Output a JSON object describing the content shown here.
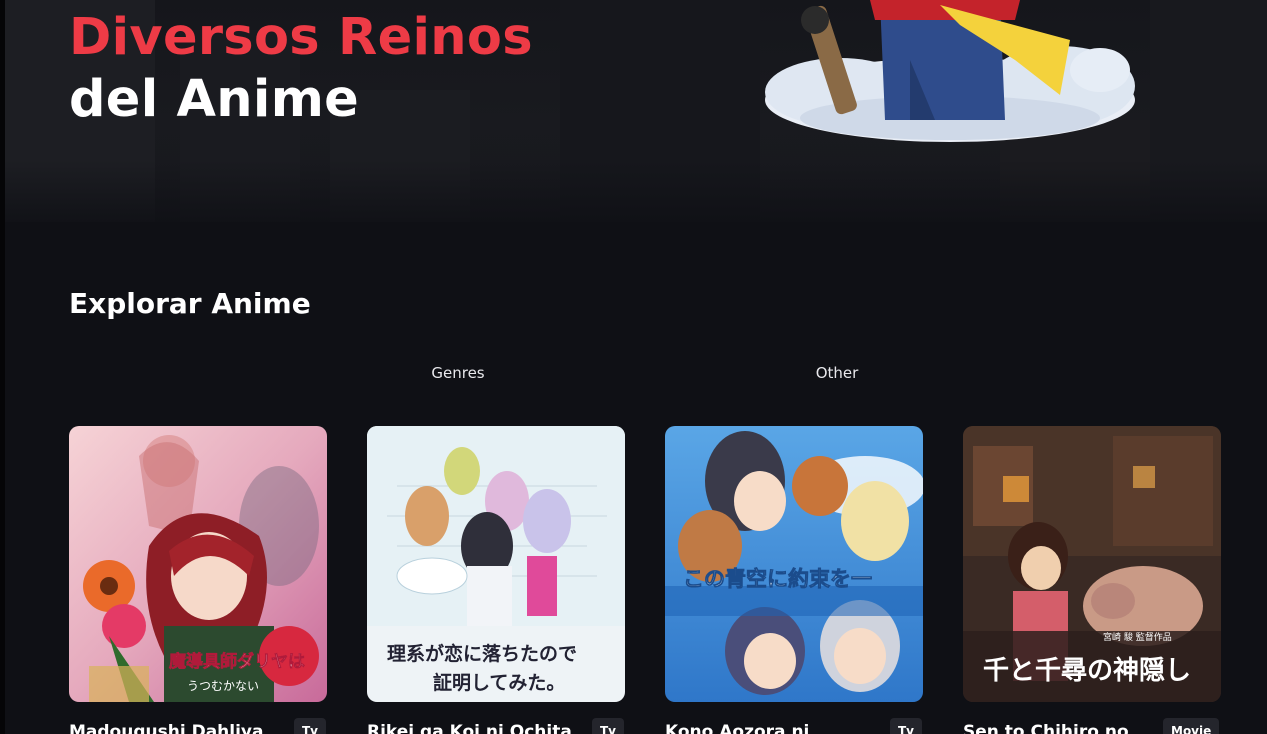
{
  "hero": {
    "title_accent": "Diversos Reinos",
    "title_main": "del Anime"
  },
  "explore": {
    "title": "Explorar Anime",
    "tabs": [
      {
        "label": "Genres"
      },
      {
        "label": "Other"
      }
    ]
  },
  "cards": [
    {
      "title": "Madougushi Dahliya",
      "type": "Tv",
      "poster_text": "魔導具師ダリヤは",
      "poster_subtext": "うつむかない"
    },
    {
      "title": "Rikei ga Koi ni Ochita",
      "type": "Tv",
      "poster_text": "理系が恋に落ちたので",
      "poster_subtext": "証明してみた。"
    },
    {
      "title": "Kono Aozora ni",
      "type": "Tv",
      "poster_text": "この青空に約束を一",
      "poster_subtext": ""
    },
    {
      "title": "Sen to Chihiro no",
      "type": "Movie",
      "poster_text": "千と千尋の神隠し",
      "poster_subtext": "宮崎 駿 監督作品"
    }
  ],
  "colors": {
    "background": "#0f1015",
    "accent": "#ee3b46",
    "badge_bg": "#24252c"
  }
}
